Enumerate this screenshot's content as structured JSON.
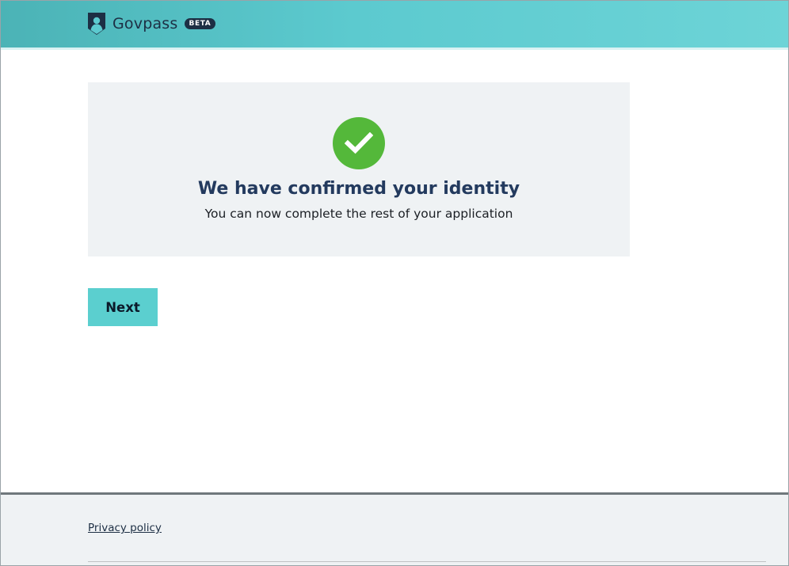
{
  "header": {
    "brand_name": "Govpass",
    "badge": "BETA",
    "icon": "shield-person-icon",
    "colors": {
      "gradient_start": "#4bb3b6",
      "gradient_end": "#6dd4d7",
      "brand_text": "#1d2f44"
    }
  },
  "confirmation": {
    "icon": "check-circle-icon",
    "title": "We have confirmed your identity",
    "subtitle": "You can now complete the rest of your application",
    "colors": {
      "success": "#54b83a",
      "panel_bg": "#eff2f4",
      "title": "#233a5e"
    }
  },
  "actions": {
    "next_label": "Next",
    "button_color": "#5bcfcf"
  },
  "footer": {
    "privacy_link": "Privacy policy"
  }
}
